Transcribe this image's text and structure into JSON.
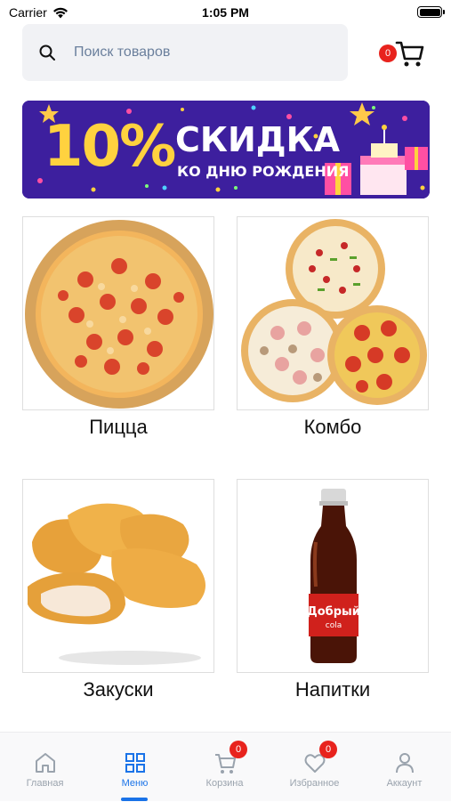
{
  "status_bar": {
    "carrier": "Carrier",
    "time": "1:05 PM"
  },
  "search": {
    "placeholder": "Поиск товаров"
  },
  "cart": {
    "count": "0"
  },
  "banner": {
    "percent": "10%",
    "title": "СКИДКА",
    "subtitle": "КО ДНЮ РОЖДЕНИЯ"
  },
  "categories": [
    {
      "label": "Пицца"
    },
    {
      "label": "Комбо"
    },
    {
      "label": "Закуски"
    },
    {
      "label": "Напитки"
    }
  ],
  "drink_brand": {
    "name": "Добрый",
    "sub": "cola"
  },
  "tabbar": {
    "items": [
      {
        "label": "Главная",
        "icon": "home-icon"
      },
      {
        "label": "Меню",
        "icon": "menu-grid-icon",
        "active": true
      },
      {
        "label": "Корзина",
        "icon": "cart-icon",
        "badge": "0"
      },
      {
        "label": "Избранное",
        "icon": "heart-icon",
        "badge": "0"
      },
      {
        "label": "Аккаунт",
        "icon": "user-icon"
      }
    ]
  },
  "colors": {
    "accent": "#1a73e8",
    "badge": "#e8231d",
    "banner_bg": "#3d1f9e",
    "banner_text": "#ffd23f"
  }
}
